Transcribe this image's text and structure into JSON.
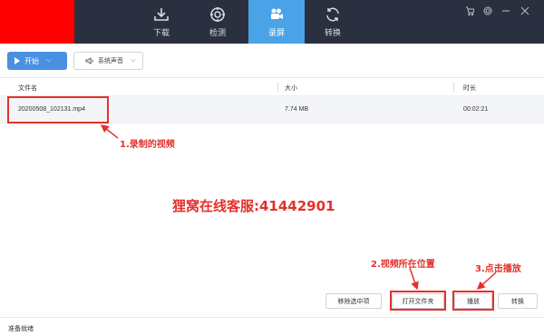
{
  "nav": {
    "tabs": [
      {
        "label": "下载",
        "icon": "download-icon"
      },
      {
        "label": "检测",
        "icon": "detect-icon"
      },
      {
        "label": "录屏",
        "icon": "video-camera-icon",
        "active": true
      },
      {
        "label": "转换",
        "icon": "convert-icon"
      }
    ]
  },
  "window_controls": [
    "cart-icon",
    "settings-icon",
    "minimize-icon",
    "close-icon"
  ],
  "toolbar": {
    "start_label": "开始",
    "audio_label": "系统声音"
  },
  "table": {
    "headers": [
      "文件名",
      "大小",
      "时长"
    ],
    "rows": [
      {
        "filename": "20200508_102131.mp4",
        "size": "7.74 MB",
        "duration": "00:02:21"
      }
    ]
  },
  "annotations": {
    "recorded_video": "1.录制的视频",
    "video_location": "2.视频所在位置",
    "click_play": "3.点击播放",
    "watermark": "狸窝在线客服:41442901"
  },
  "actions": {
    "remove_label": "移除选中项",
    "open_folder_label": "打开文件夹",
    "play_label": "播放",
    "convert_label": "转换"
  },
  "status": {
    "text": "准备就绪"
  },
  "colors": {
    "topbar": "#2b3040",
    "active_tab": "#4aa3e6",
    "accent": "#4a90e2",
    "annotation_red": "#e4312b",
    "logo_placeholder": "#ff0000"
  }
}
